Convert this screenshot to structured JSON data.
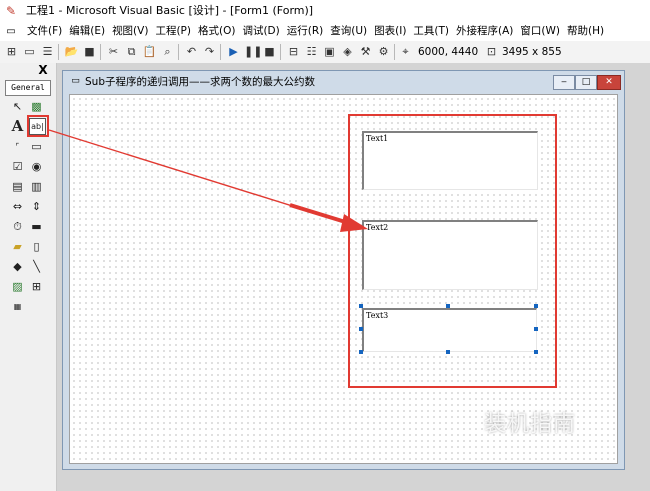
{
  "window": {
    "title": "工程1 - Microsoft Visual Basic [设计] - [Form1 (Form)]"
  },
  "menu": {
    "items": [
      "文件(F)",
      "编辑(E)",
      "视图(V)",
      "工程(P)",
      "格式(O)",
      "调试(D)",
      "运行(R)",
      "查询(U)",
      "图表(I)",
      "工具(T)",
      "外接程序(A)",
      "窗口(W)",
      "帮助(H)"
    ]
  },
  "toolbar": {
    "position_readout": "6000, 4440",
    "size_readout": "3495 x 855"
  },
  "toolbox": {
    "close_label": "X",
    "tab_label": "General"
  },
  "form": {
    "caption": "Sub子程序的递归调用——求两个数的最大公约数",
    "controls": {
      "text1": "Text1",
      "text2": "Text2",
      "text3": "Text3"
    }
  },
  "annotation": {
    "color": "#e13a32"
  },
  "watermark": {
    "text": "装机指南"
  }
}
